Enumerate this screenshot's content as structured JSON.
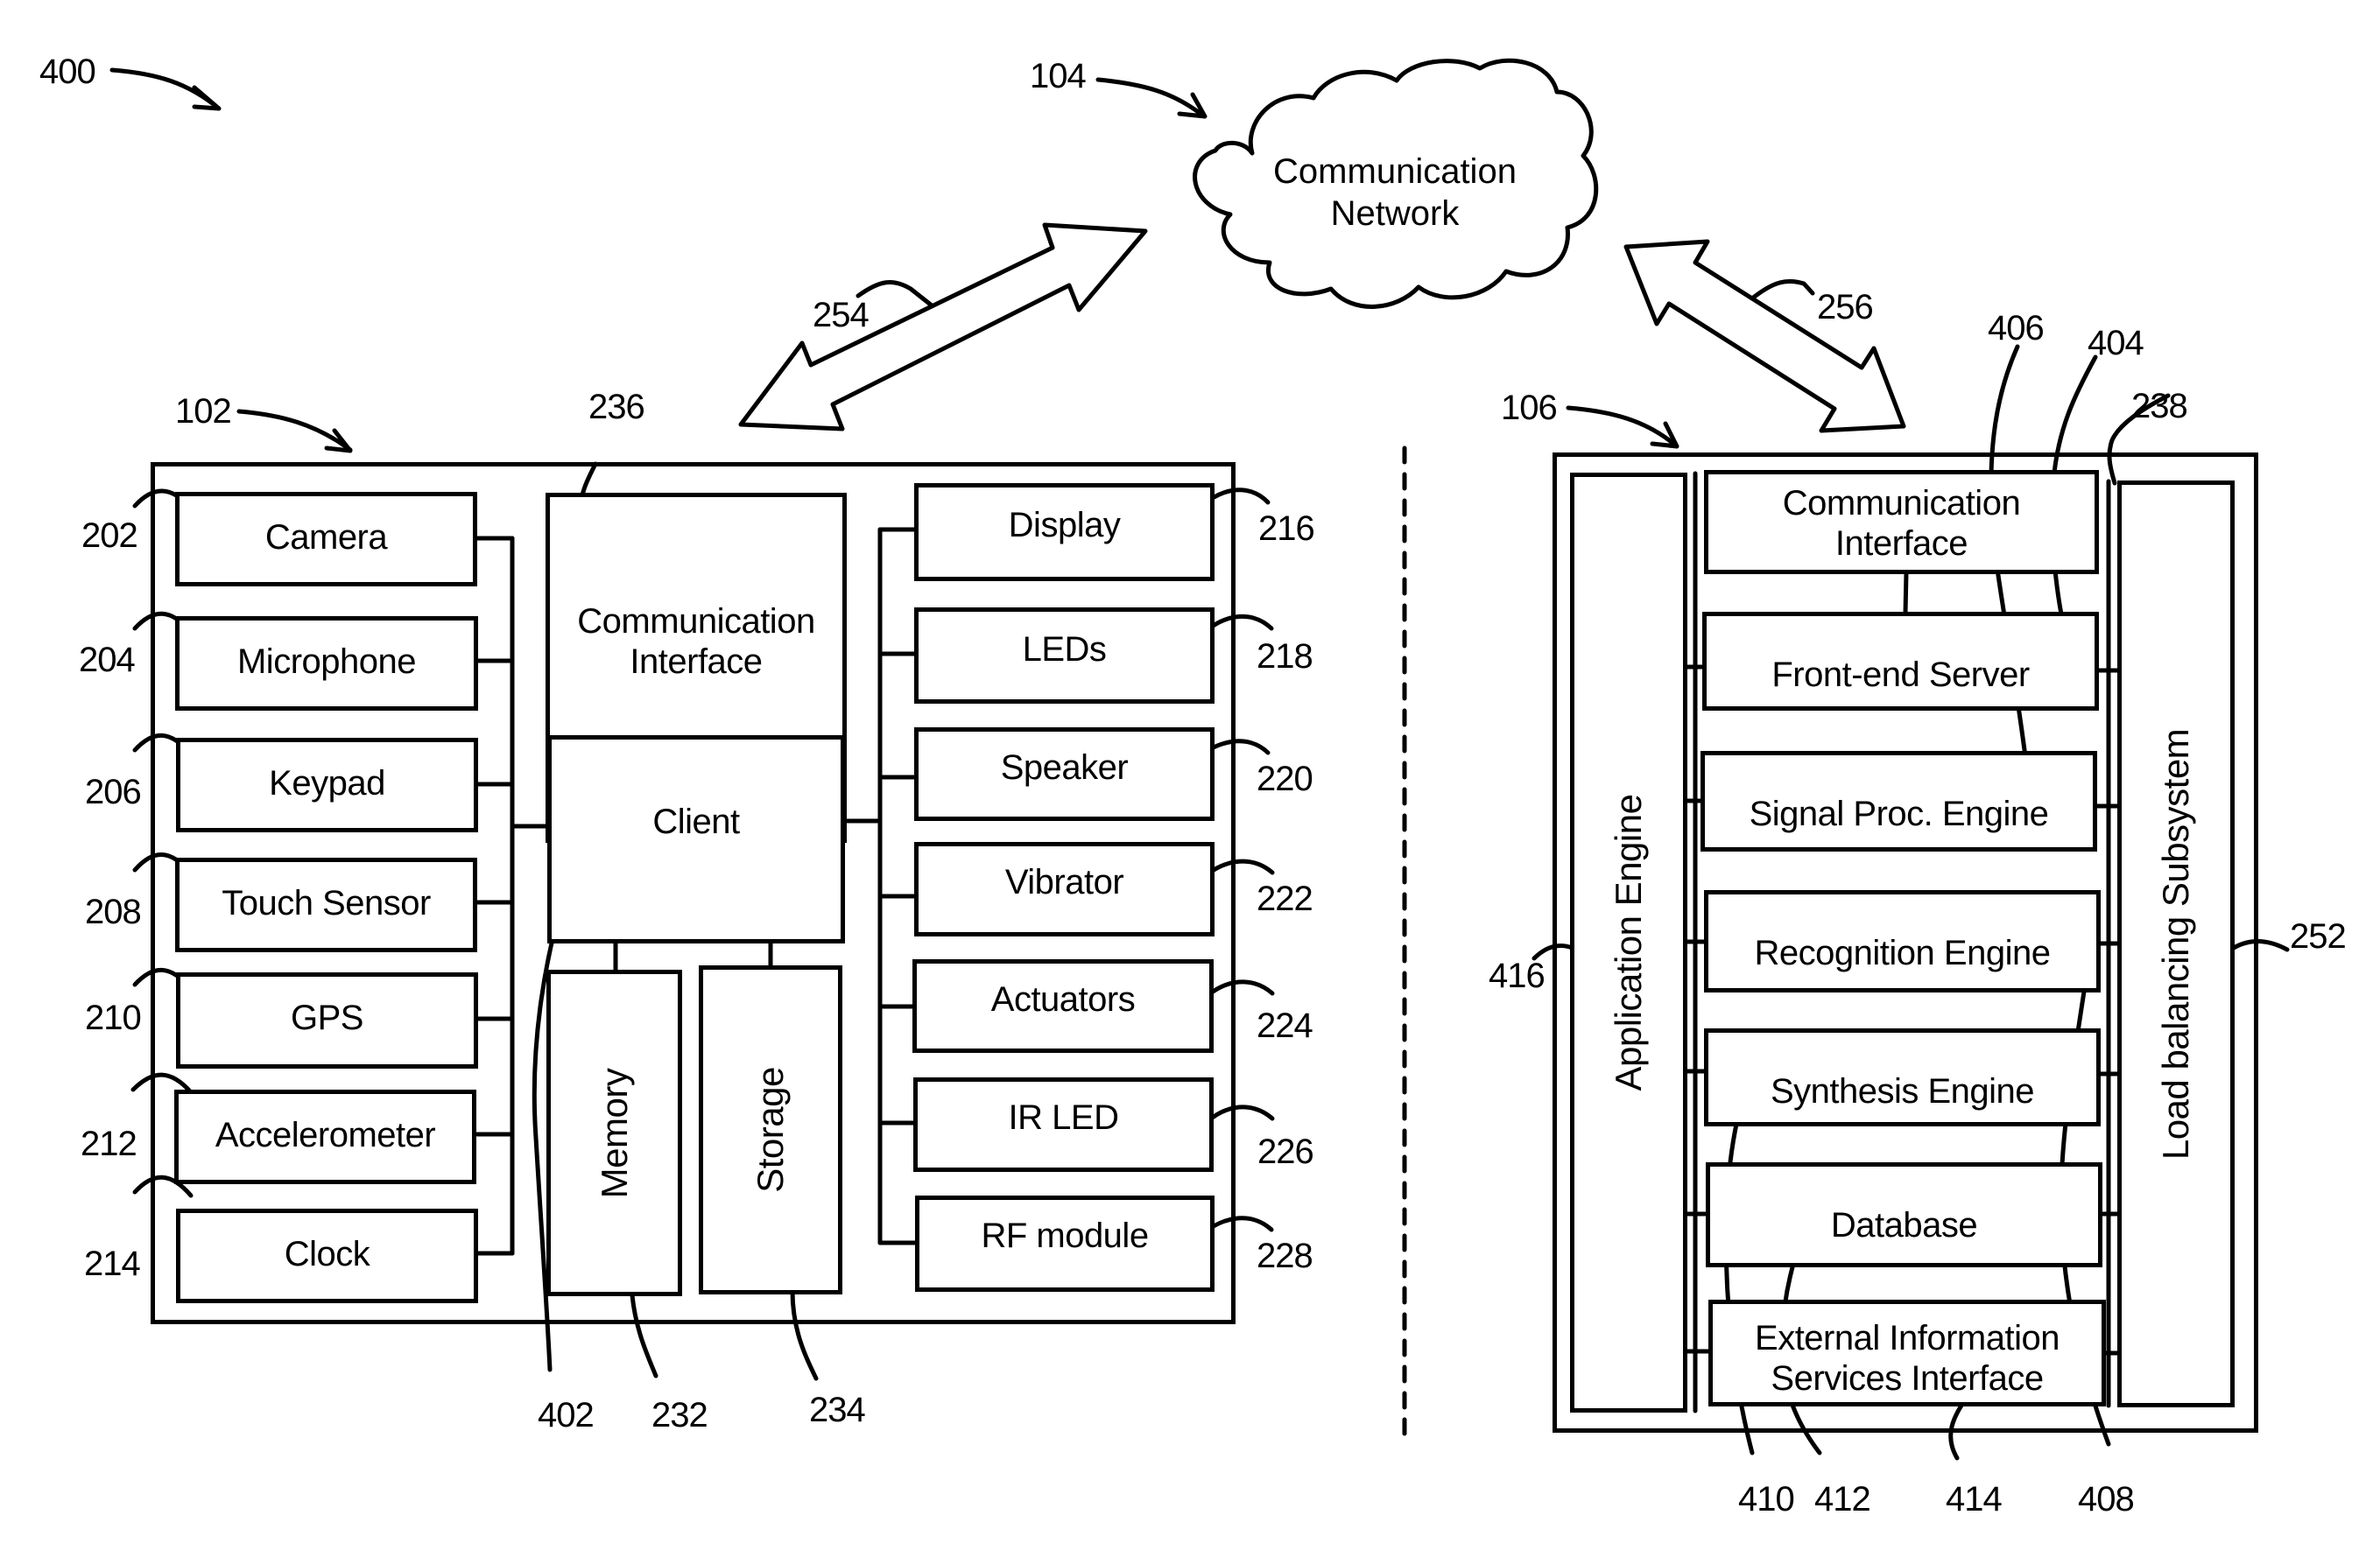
{
  "figure": {
    "system_ref": "400",
    "network": {
      "ref": "104",
      "label_line1": "Communication",
      "label_line2": "Network"
    },
    "links": [
      {
        "ref": "254",
        "between": [
          "102",
          "104"
        ]
      },
      {
        "ref": "256",
        "between": [
          "104",
          "106"
        ]
      }
    ],
    "client_device": {
      "ref": "102",
      "left_components": [
        {
          "ref": "202",
          "label": "Camera"
        },
        {
          "ref": "204",
          "label": "Microphone"
        },
        {
          "ref": "206",
          "label": "Keypad"
        },
        {
          "ref": "208",
          "label": "Touch Sensor"
        },
        {
          "ref": "210",
          "label": "GPS"
        },
        {
          "ref": "212",
          "label": "Accelerometer"
        },
        {
          "ref": "214",
          "label": "Clock"
        }
      ],
      "center": {
        "comm_interface": {
          "ref": "236",
          "line1": "Communication",
          "line2": "Interface"
        },
        "client": {
          "ref": "402",
          "label": "Client"
        },
        "memory": {
          "ref": "232",
          "label": "Memory"
        },
        "storage": {
          "ref": "234",
          "label": "Storage"
        }
      },
      "right_components": [
        {
          "ref": "216",
          "label": "Display"
        },
        {
          "ref": "218",
          "label": "LEDs"
        },
        {
          "ref": "220",
          "label": "Speaker"
        },
        {
          "ref": "222",
          "label": "Vibrator"
        },
        {
          "ref": "224",
          "label": "Actuators"
        },
        {
          "ref": "226",
          "label": "IR LED"
        },
        {
          "ref": "228",
          "label": "RF module"
        }
      ]
    },
    "server": {
      "ref": "106",
      "application_engine": {
        "ref": "416",
        "label": "Application Engine"
      },
      "load_balancing": {
        "ref": "252",
        "label": "Load balancing Subsystem"
      },
      "modules": [
        {
          "ref": "238",
          "line1": "Communication",
          "line2": "Interface"
        },
        {
          "ref": "404",
          "line1": "Front-end Server",
          "line2": ""
        },
        {
          "ref": "406",
          "line1": "Signal Proc. Engine",
          "line2": ""
        },
        {
          "ref": "408",
          "line1": "Recognition Engine",
          "line2": ""
        },
        {
          "ref": "410",
          "line1": "Synthesis Engine",
          "line2": ""
        },
        {
          "ref": "412",
          "line1": "Database",
          "line2": ""
        },
        {
          "ref": "414",
          "line1": "External Information",
          "line2": "Services Interface"
        }
      ]
    }
  }
}
